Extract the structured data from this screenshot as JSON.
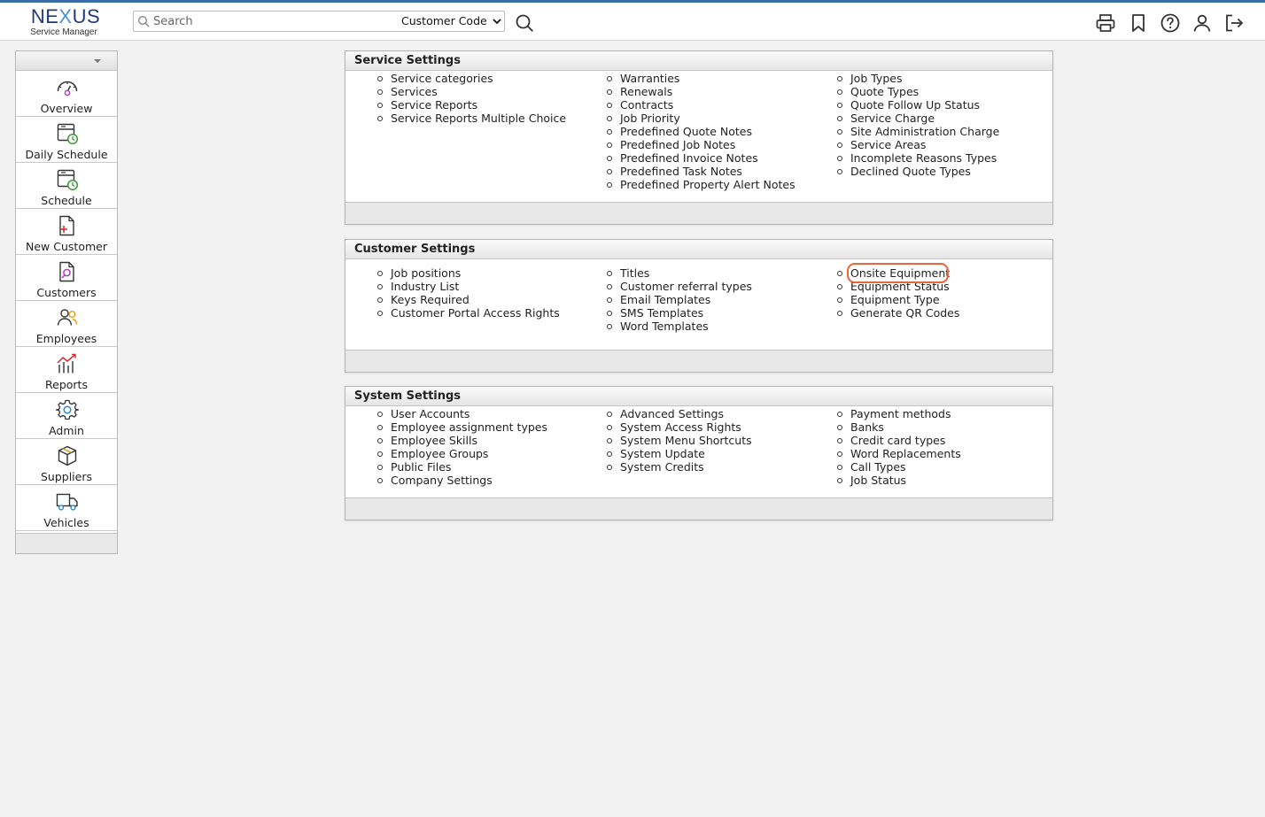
{
  "header": {
    "logo_main_a": "NE",
    "logo_main_x": "X",
    "logo_main_b": "US",
    "logo_sub": "Service Manager",
    "search_placeholder": "Search",
    "search_mode": "Customer Code",
    "icons": [
      "print-icon",
      "bookmark-icon",
      "help-icon",
      "user-icon",
      "logout-icon"
    ]
  },
  "sidebar": {
    "items": [
      {
        "label": "Overview",
        "icon": "gauge-icon"
      },
      {
        "label": "Daily Schedule",
        "icon": "calendar-clock-icon"
      },
      {
        "label": "Schedule",
        "icon": "calendar-clock-icon"
      },
      {
        "label": "New Customer",
        "icon": "new-document-icon"
      },
      {
        "label": "Customers",
        "icon": "document-search-icon"
      },
      {
        "label": "Employees",
        "icon": "people-icon"
      },
      {
        "label": "Reports",
        "icon": "chart-icon"
      },
      {
        "label": "Admin",
        "icon": "gear-icon"
      },
      {
        "label": "Suppliers",
        "icon": "box-icon"
      },
      {
        "label": "Vehicles",
        "icon": "truck-icon"
      }
    ]
  },
  "panels": {
    "service": {
      "title": "Service Settings",
      "col1": [
        "Service categories",
        "Services",
        "Service Reports",
        "Service Reports Multiple Choice"
      ],
      "col2": [
        "Warranties",
        "Renewals",
        "Contracts",
        "Job Priority",
        "Predefined Quote Notes",
        "Predefined Job Notes",
        "Predefined Invoice Notes",
        "Predefined Task Notes",
        "Predefined Property Alert Notes"
      ],
      "col3": [
        "Job Types",
        "Quote Types",
        "Quote Follow Up Status",
        "Service Charge",
        "Site Administration Charge",
        "Service Areas",
        "Incomplete Reasons Types",
        "Declined Quote Types"
      ]
    },
    "customer": {
      "title": "Customer Settings",
      "col1": [
        "Job positions",
        "Industry List",
        "Keys Required",
        "Customer Portal Access Rights"
      ],
      "col2": [
        "Titles",
        "Customer referral types",
        "Email Templates",
        "SMS Templates",
        "Word Templates"
      ],
      "col3": [
        "Onsite Equipment",
        "Equipment Status",
        "Equipment Type",
        "Generate QR Codes"
      ]
    },
    "system": {
      "title": "System Settings",
      "col1": [
        "User Accounts",
        "Employee assignment types",
        "Employee Skills",
        "Employee Groups",
        "Public Files",
        "Company Settings"
      ],
      "col2": [
        "Advanced Settings",
        "System Access Rights",
        "System Menu Shortcuts",
        "System Update",
        "System Credits"
      ],
      "col3": [
        "Payment methods",
        "Banks",
        "Credit card types",
        "Word Replacements",
        "Call Types",
        "Job Status"
      ]
    }
  },
  "highlight_color": "#e8673a",
  "accent_color": "#3b6ea8"
}
